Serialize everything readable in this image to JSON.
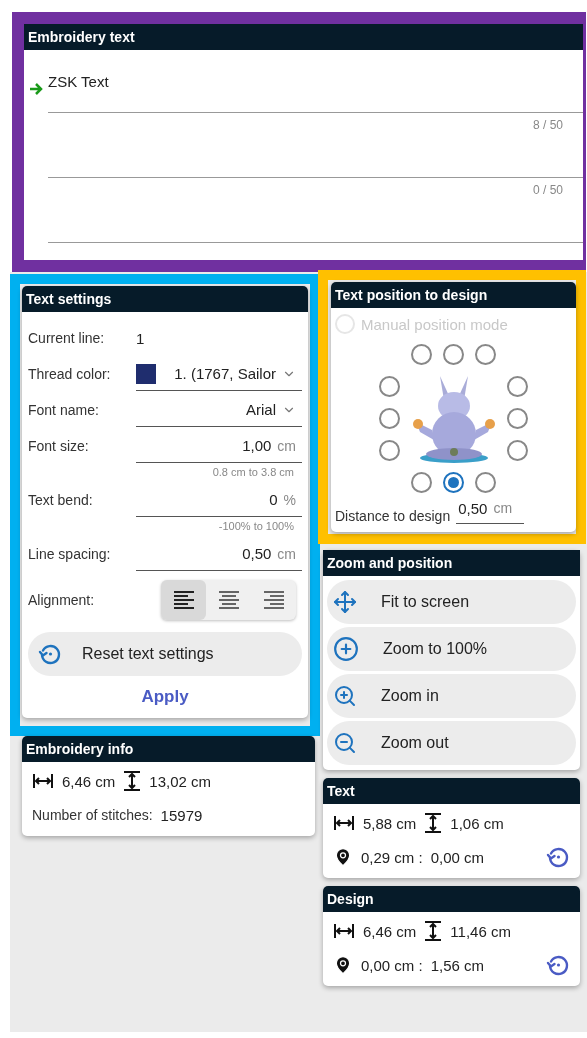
{
  "embroidery_text": {
    "title": "Embroidery text",
    "lines": [
      {
        "current": true,
        "value": "ZSK Text",
        "counter": "8 / 50"
      },
      {
        "current": false,
        "counter": "0 / 50"
      },
      {
        "current": false
      }
    ]
  },
  "text_settings": {
    "title": "Text settings",
    "fields": [
      {
        "kind": "static",
        "label": "Current line:",
        "value": "1"
      },
      {
        "kind": "color_select",
        "label": "Thread color:",
        "value": "1. (1767, Sailor",
        "color": "#1f2d6e"
      },
      {
        "kind": "select",
        "label": "Font name:",
        "value": "Arial"
      },
      {
        "kind": "number",
        "label": "Font size:",
        "value": "1,00",
        "unit": "cm",
        "hint": "0.8 cm to 3.8 cm"
      },
      {
        "kind": "number",
        "label": "Text bend:",
        "value": "0",
        "unit": "%",
        "hint": "-100% to 100%"
      },
      {
        "kind": "number",
        "label": "Line spacing:",
        "value": "0,50",
        "unit": "cm"
      }
    ],
    "alignment": {
      "label": "Alignment:",
      "options": [
        {
          "kind": "left",
          "selected": true
        },
        {
          "kind": "center",
          "selected": false
        },
        {
          "kind": "right",
          "selected": false
        }
      ]
    },
    "reset_button": "Reset text settings",
    "apply_button": "Apply"
  },
  "position": {
    "title": "Text position to design",
    "manual_mode": {
      "label": "Manual position mode",
      "checked": false,
      "disabled": true
    },
    "positions": [
      {
        "selected": false
      },
      {
        "selected": false
      },
      {
        "selected": false
      },
      {
        "selected": false
      },
      {
        "selected": false
      },
      {
        "selected": false
      },
      {
        "selected": false
      },
      {
        "selected": false
      },
      {
        "selected": false
      },
      {
        "selected": false
      },
      {
        "selected": true
      },
      {
        "selected": false
      }
    ],
    "distance": {
      "label": "Distance to design",
      "value": "0,50",
      "unit": "cm"
    }
  },
  "zoom": {
    "title": "Zoom and position",
    "buttons": [
      {
        "kind": "fit",
        "label": "Fit to screen"
      },
      {
        "kind": "zoom_100",
        "label": "Zoom to 100%"
      },
      {
        "kind": "zoom_in",
        "label": "Zoom in"
      },
      {
        "kind": "zoom_out",
        "label": "Zoom out"
      }
    ]
  },
  "embroidery_info": {
    "title": "Embroidery info",
    "width": "6,46 cm",
    "height": "13,02 cm",
    "stitches_label": "Number of stitches:",
    "stitches": "15979"
  },
  "text_info": {
    "title": "Text",
    "width": "5,88 cm",
    "height": "1,06 cm",
    "x": "0,29 cm :",
    "y": "0,00 cm"
  },
  "design_info": {
    "title": "Design",
    "width": "6,46 cm",
    "height": "11,46 cm",
    "x": "0,00 cm :",
    "y": "1,56 cm"
  }
}
